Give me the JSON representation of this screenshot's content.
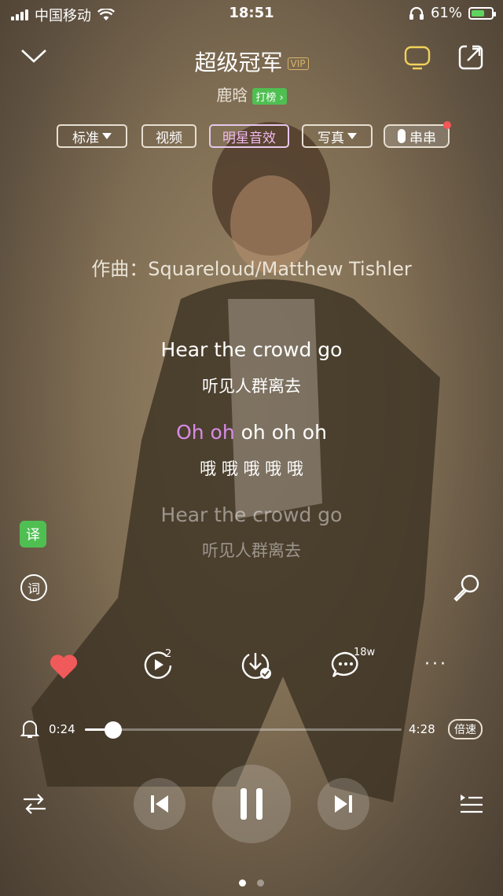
{
  "status": {
    "carrier": "中国移动",
    "time": "18:51",
    "battery": "61%"
  },
  "song": {
    "title": "超级冠军",
    "vip_badge": "VIP",
    "artist": "鹿晗",
    "chart_badge": "打榜 ›"
  },
  "chips": [
    {
      "label": "标准"
    },
    {
      "label": "视频"
    },
    {
      "label": "明星音效"
    },
    {
      "label": "写真"
    },
    {
      "label": "串串"
    }
  ],
  "lyrics": {
    "composer": "作曲：Squareloud/Matthew Tishler",
    "line1_en": "Hear the crowd go",
    "line1_cn": "听见人群离去",
    "line2_en_hl": "Oh oh",
    "line2_en_rest": " oh oh oh",
    "line2_cn": "哦 哦 哦 哦 哦",
    "line3_en": "Hear the crowd go",
    "line3_cn": "听见人群离去"
  },
  "side": {
    "translate_label": "译",
    "lyric_label": "词"
  },
  "actions": {
    "play_count_badge": "2",
    "comment_count": "18w",
    "more": "···"
  },
  "player": {
    "current_time": "0:24",
    "total_time": "4:28",
    "speed_label": "倍速",
    "progress": 0.09
  },
  "colors": {
    "accent": "#d88be8",
    "like": "#f05a5a",
    "badge_green": "#4fbf52",
    "vip": "#d8b36a"
  },
  "icons": {
    "status": [
      "signal-icon",
      "wifi-icon",
      "headphones-icon",
      "battery-icon"
    ],
    "header": [
      "chevron-down-icon",
      "tv-icon",
      "share-icon"
    ],
    "actions": [
      "heart-icon",
      "play-count-icon",
      "download-icon",
      "comment-icon",
      "more-icon"
    ],
    "controls": [
      "shuffle-icon",
      "previous-icon",
      "pause-icon",
      "next-icon",
      "playlist-icon"
    ]
  },
  "pager": {
    "total": 2,
    "active": 0
  }
}
